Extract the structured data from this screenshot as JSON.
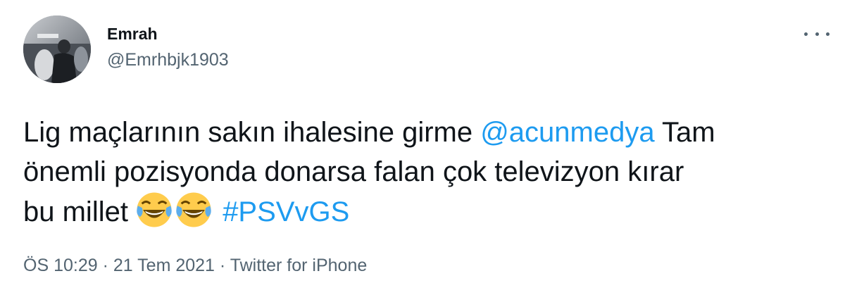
{
  "user": {
    "display_name": "Emrah",
    "handle": "@Emrhbjk1903"
  },
  "tweet": {
    "line1_text": "Lig maçlarının sakın ihalesine girme ",
    "mention": "@acunmedya",
    "line1_tail": " Tam",
    "line2_text": "önemli pozisyonda donarsa falan çok televizyon kırar",
    "line3_text": "bu millet ",
    "emoji_1": "face-with-tears-of-joy",
    "emoji_2": "face-with-tears-of-joy",
    "hashtag": "#PSVvGS"
  },
  "meta": {
    "time": "ÖS 10:29",
    "sep1": " · ",
    "date": "21 Tem 2021",
    "sep2": " · ",
    "source": "Twitter for iPhone"
  },
  "icons": {
    "more": "more-options-icon"
  },
  "colors": {
    "link": "#1d9bf0",
    "secondary_text": "#536471",
    "primary_text": "#0f1419"
  }
}
